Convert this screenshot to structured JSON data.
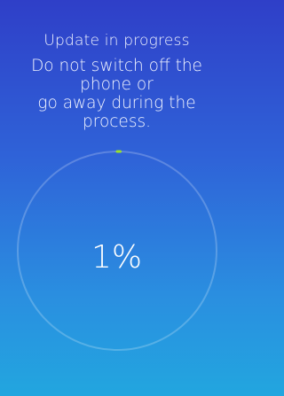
{
  "update": {
    "title": "Update in progress",
    "warning_lines": [
      "Do not switch off the",
      "phone or",
      "go away during the",
      "process."
    ],
    "progress_percent": 1,
    "progress_text": "1%"
  },
  "colors": {
    "background_top": "#2f3fc8",
    "background_bottom": "#22a6df",
    "ring_track": "#ffffff",
    "ring_progress": "#9be22a",
    "text": "#ffffff"
  }
}
